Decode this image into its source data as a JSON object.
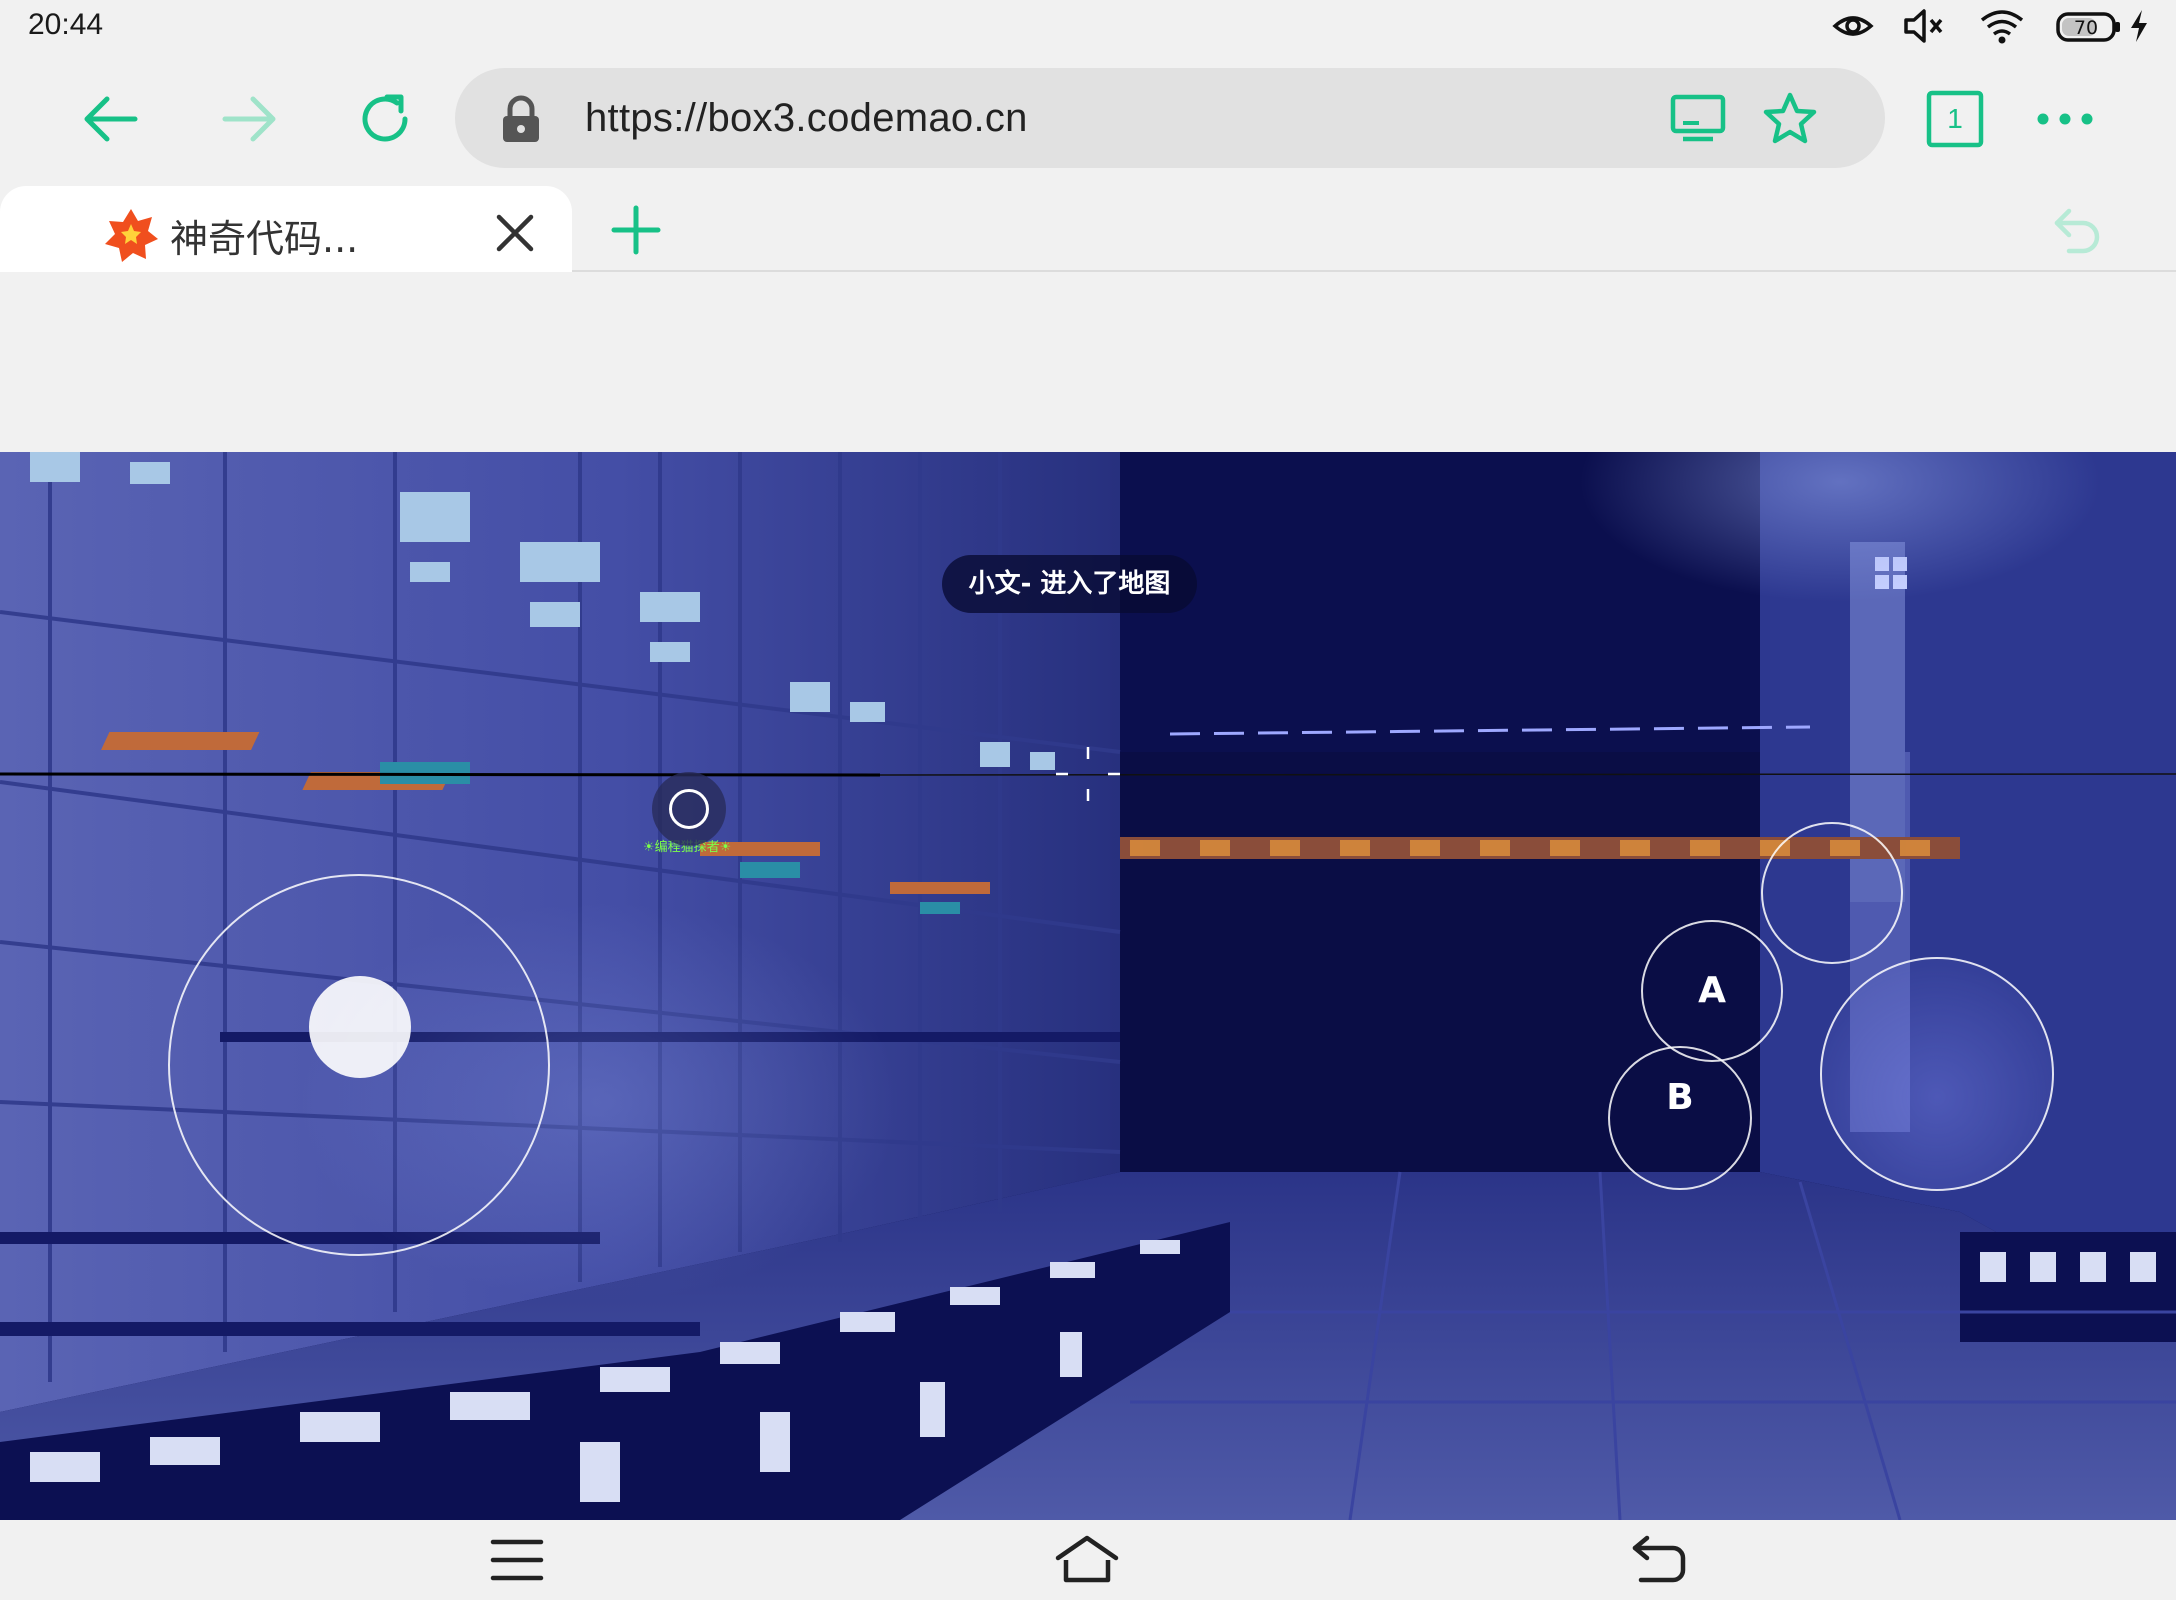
{
  "status_bar": {
    "time": "20:44",
    "icons": [
      "eye-icon",
      "volume-muted-icon",
      "wifi-icon",
      "battery-icon",
      "charging-icon"
    ],
    "battery_level": "70"
  },
  "toolbar": {
    "url": "https://box3.codemao.cn",
    "tab_count": "1",
    "accent_color": "#17c187",
    "icons": [
      "back-arrow-icon",
      "forward-arrow-icon",
      "reload-icon",
      "lock-icon",
      "desktop-mode-icon",
      "star-icon",
      "tab-counter-icon",
      "more-icon"
    ]
  },
  "tabs": [
    {
      "title": "神奇代码...",
      "active": true
    }
  ],
  "tab_strip": {
    "icons": [
      "close-icon",
      "new-tab-plus-icon",
      "undo-icon"
    ]
  },
  "game": {
    "notification": "小文- 进入了地图",
    "player_name": "☀编程猫探者☀",
    "buttons": {
      "a_label": "A",
      "b_label": "B"
    }
  },
  "nav_bar": {
    "icons": [
      "menu-icon",
      "home-icon",
      "back-icon"
    ]
  }
}
